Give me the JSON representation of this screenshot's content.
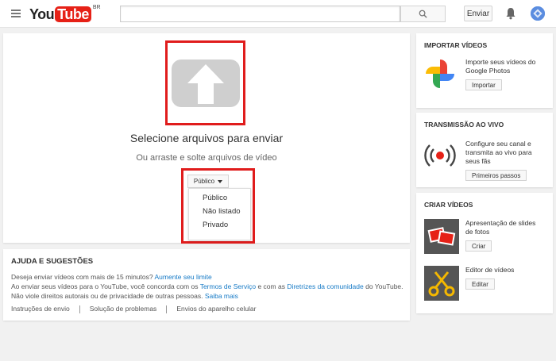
{
  "header": {
    "logo_you": "You",
    "logo_tube": "Tube",
    "logo_region": "BR",
    "search_placeholder": "",
    "upload_button": "Enviar"
  },
  "upload": {
    "title": "Selecione arquivos para enviar",
    "subtitle": "Ou arraste e solte arquivos de vídeo",
    "privacy_selected": "Público",
    "privacy_options": [
      "Público",
      "Não listado",
      "Privado"
    ]
  },
  "help": {
    "title": "AJUDA E SUGESTÕES",
    "line1_text": "Deseja enviar vídeos com mais de 15 minutos?",
    "line1_link": "Aumente seu limite",
    "line2_text_a": "Ao enviar seus vídeos para o YouTube, você concorda com os",
    "line2_link_a": "Termos de Serviço",
    "line2_text_b": "e com as",
    "line2_link_b": "Diretrizes da comunidade",
    "line2_text_c": "do YouTube.",
    "line3_text": "Não viole direitos autorais ou de privacidade de outras pessoas.",
    "line3_link": "Saiba mais",
    "links": [
      "Instruções de envio",
      "Solução de problemas",
      "Envios do aparelho celular"
    ]
  },
  "sidebar": {
    "import": {
      "title": "IMPORTAR VÍDEOS",
      "text": "Importe seus vídeos do Google Photos",
      "button": "Importar"
    },
    "live": {
      "title": "TRANSMISSÃO AO VIVO",
      "text": "Configure seu canal e transmita ao vivo para seus fãs",
      "button": "Primeiros passos"
    },
    "create": {
      "title": "CRIAR VÍDEOS",
      "slides_text": "Apresentação de slides de fotos",
      "slides_button": "Criar",
      "editor_text": "Editor de vídeos",
      "editor_button": "Editar"
    }
  },
  "colors": {
    "brand_red": "#e62117",
    "highlight_red": "#e01c1c",
    "link_blue": "#167ac6"
  }
}
